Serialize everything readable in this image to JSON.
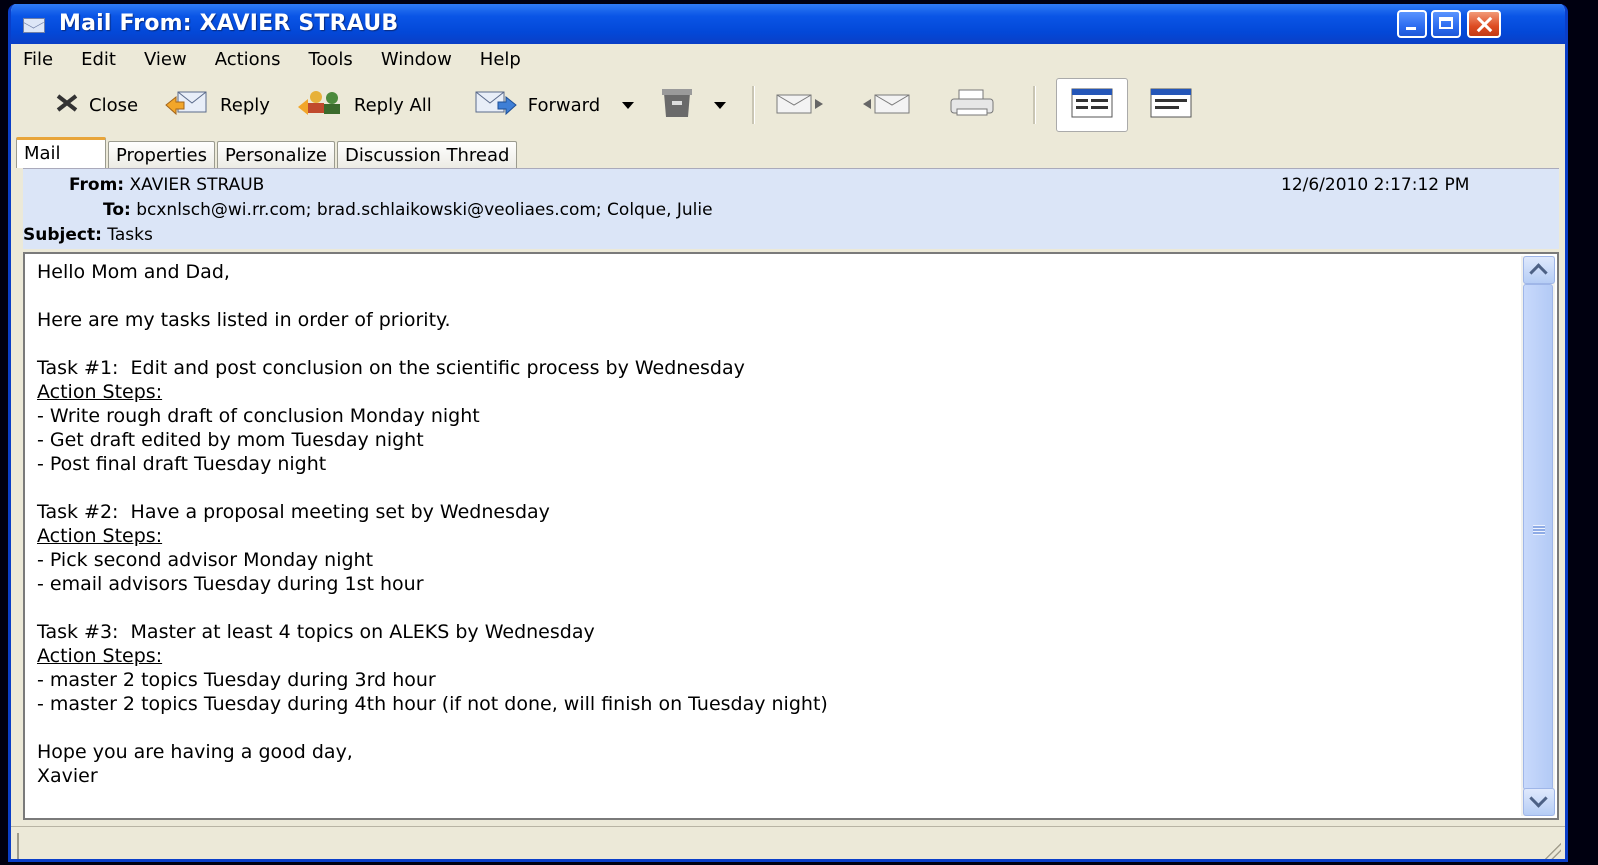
{
  "window": {
    "title": "Mail From: XAVIER STRAUB"
  },
  "menu": [
    "File",
    "Edit",
    "View",
    "Actions",
    "Tools",
    "Window",
    "Help"
  ],
  "toolbar": {
    "close": "Close",
    "reply": "Reply",
    "reply_all": "Reply All",
    "forward": "Forward"
  },
  "tabs": [
    "Mail",
    "Properties",
    "Personalize",
    "Discussion Thread"
  ],
  "header": {
    "from_label": "From:",
    "from": "XAVIER STRAUB",
    "to_label": "To:",
    "to": "bcxnlsch@wi.rr.com; brad.schlaikowski@veoliaes.com; Colque, Julie",
    "subject_label": "Subject:",
    "subject": "Tasks",
    "date": "12/6/2010 2:17:12 PM"
  },
  "message": {
    "greeting": "Hello Mom and Dad,",
    "intro": "Here are my tasks listed in order of priority.",
    "action_label": "Action Steps:",
    "task1": "Task #1:  Edit and post conclusion on the scientific process by Wednesday",
    "task1_steps": [
      "- Write rough draft of conclusion Monday night",
      "- Get draft edited by mom Tuesday night",
      "- Post final draft Tuesday night"
    ],
    "task2": "Task #2:  Have a proposal meeting set by Wednesday",
    "task2_steps": [
      "- Pick second advisor Monday night",
      "- email advisors Tuesday during 1st hour"
    ],
    "task3": "Task #3:  Master at least 4 topics on ALEKS by Wednesday",
    "task3_steps": [
      "- master 2 topics Tuesday during 3rd hour",
      "- master 2 topics Tuesday during 4th hour (if not done, will finish on Tuesday night)"
    ],
    "closing": "Hope you are having a good day,",
    "signature": "Xavier"
  }
}
